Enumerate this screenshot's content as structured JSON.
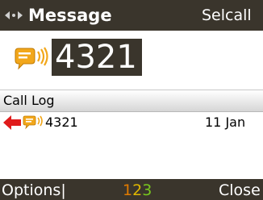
{
  "titlebar": {
    "title": "Message",
    "right_action": "Selcall",
    "nav_icon": "left-right-arrows-icon"
  },
  "entry": {
    "number": "4321",
    "icon": "message-sending-icon"
  },
  "call_log": {
    "header": "Call Log",
    "items": [
      {
        "direction_icon": "outgoing-arrow-icon",
        "type_icon": "message-icon",
        "number": "4321",
        "date": "11 Jan"
      }
    ]
  },
  "softkeys": {
    "left": "Options",
    "mode_digits": [
      "1",
      "2",
      "3"
    ],
    "mode_colors": [
      "#e07a00",
      "#e0b800",
      "#78c81e"
    ],
    "right": "Close"
  },
  "colors": {
    "bar_bg": "#3a352c",
    "icon_orange": "#f2a71b",
    "arrow_red": "#e01b1b"
  }
}
